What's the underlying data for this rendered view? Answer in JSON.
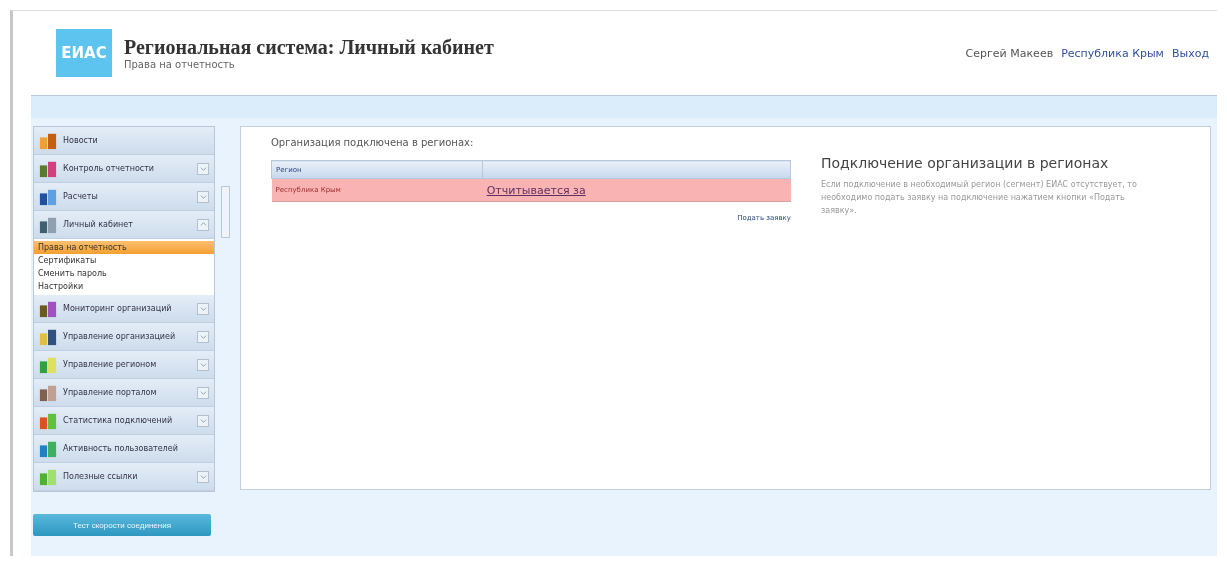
{
  "header": {
    "logo": "ЕИАС",
    "title": "Региональная система:",
    "title_bold": "Личный кабинет",
    "subtitle": "Права на отчетность",
    "user": "Сергей Макеев",
    "region_link": "Республика Крым",
    "logout_link": "Выход"
  },
  "sidebar": {
    "items": [
      {
        "label": "Новости",
        "kind": "link",
        "expanded": false
      },
      {
        "label": "Контроль отчетности",
        "kind": "group",
        "expanded": false
      },
      {
        "label": "Расчеты",
        "kind": "group",
        "expanded": false
      },
      {
        "label": "Личный кабинет",
        "kind": "group",
        "expanded": true,
        "children": [
          {
            "label": "Права на отчетность",
            "selected": true
          },
          {
            "label": "Сертификаты",
            "selected": false
          },
          {
            "label": "Сменить пароль",
            "selected": false
          },
          {
            "label": "Настройки",
            "selected": false
          }
        ]
      },
      {
        "label": "Мониторинг организаций",
        "kind": "group",
        "expanded": false
      },
      {
        "label": "Управление организацией",
        "kind": "group",
        "expanded": false
      },
      {
        "label": "Управление регионом",
        "kind": "group",
        "expanded": false
      },
      {
        "label": "Управление порталом",
        "kind": "group",
        "expanded": false
      },
      {
        "label": "Статистика подключений",
        "kind": "group",
        "expanded": false
      },
      {
        "label": "Активность пользователей",
        "kind": "link",
        "expanded": false
      },
      {
        "label": "Полезные ссылки",
        "kind": "group",
        "expanded": false
      }
    ],
    "button": "Тест скорости соединения"
  },
  "main": {
    "heading": "Организация подключена в регионах:",
    "table": {
      "columns": [
        "Регион",
        ""
      ],
      "rows": [
        {
          "cells": [
            "Республика Крым",
            "Отчитывается за"
          ],
          "highlighted": true
        }
      ]
    },
    "request_link": "Подать заявку"
  },
  "info": {
    "title": "Подключение организации в регионах",
    "text": "Если подключение в необходимый регион (сегмент) ЕИАС отсутствует, то необходимо подать заявку на подключение нажатием кнопки «Подать заявку»."
  }
}
